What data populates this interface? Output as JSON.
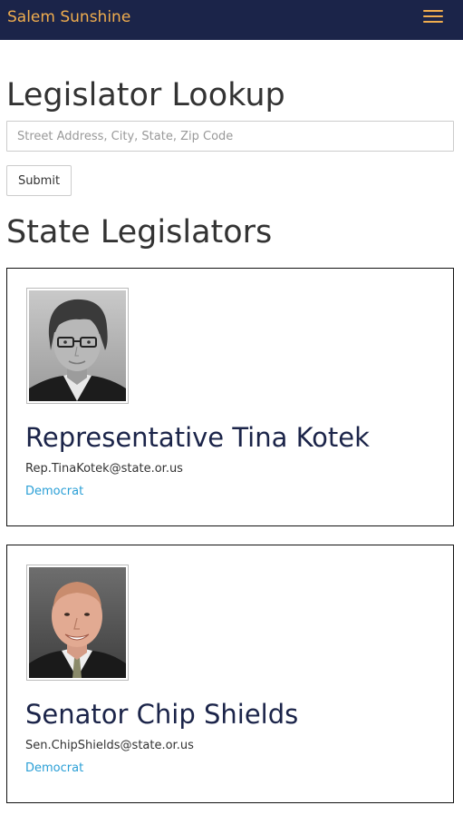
{
  "navbar": {
    "brand": "Salem Sunshine",
    "menu_icon": "hamburger-menu-icon",
    "brand_color": "#f0ad4e",
    "background": "#1b2449"
  },
  "lookup": {
    "heading": "Legislator Lookup",
    "address_placeholder": "Street Address, City, State, Zip Code",
    "address_value": "",
    "submit_label": "Submit"
  },
  "legislators": {
    "heading": "State Legislators",
    "items": [
      {
        "name": "Representative Tina Kotek",
        "email": "Rep.TinaKotek@state.or.us",
        "party": "Democrat"
      },
      {
        "name": "Senator Chip Shields",
        "email": "Sen.ChipShields@state.or.us",
        "party": "Democrat"
      }
    ]
  },
  "colors": {
    "party_link": "#2a9fd6",
    "name_text": "#1b2449"
  }
}
